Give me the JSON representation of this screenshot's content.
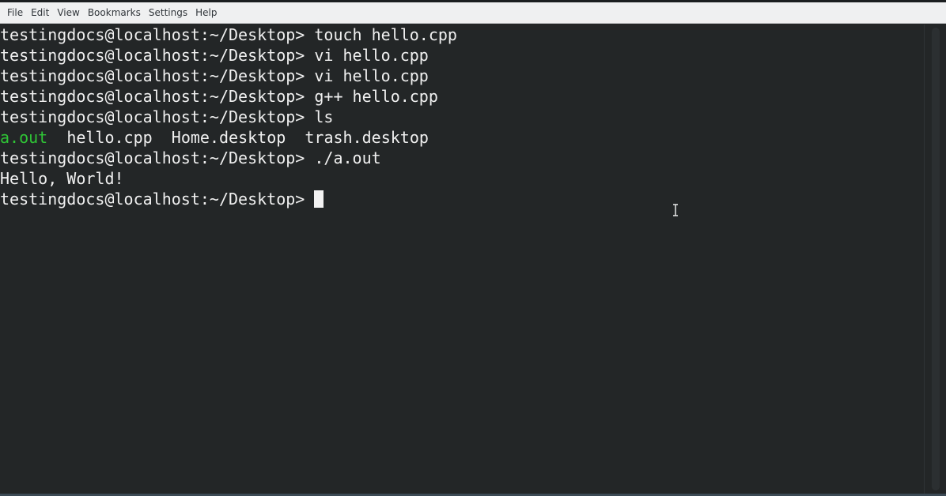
{
  "menubar": {
    "items": [
      "File",
      "Edit",
      "View",
      "Bookmarks",
      "Settings",
      "Help"
    ]
  },
  "terminal": {
    "prompt": "testingdocs@localhost:~/Desktop> ",
    "commands": [
      "touch hello.cpp",
      "vi hello.cpp",
      "vi hello.cpp",
      "g++ hello.cpp",
      "ls"
    ],
    "ls_output": {
      "executable": "a.out",
      "files": [
        "hello.cpp",
        "Home.desktop",
        "trash.desktop"
      ]
    },
    "run_command": "./a.out",
    "program_output": "Hello, World!"
  },
  "colors": {
    "background": "#232627",
    "text": "#f0f0f0",
    "executable": "#2fc436",
    "menubar": "#eff0f1"
  },
  "icons": {
    "mouse_cursor": "i-beam-cursor-icon",
    "text_cursor": "block-cursor-icon"
  }
}
